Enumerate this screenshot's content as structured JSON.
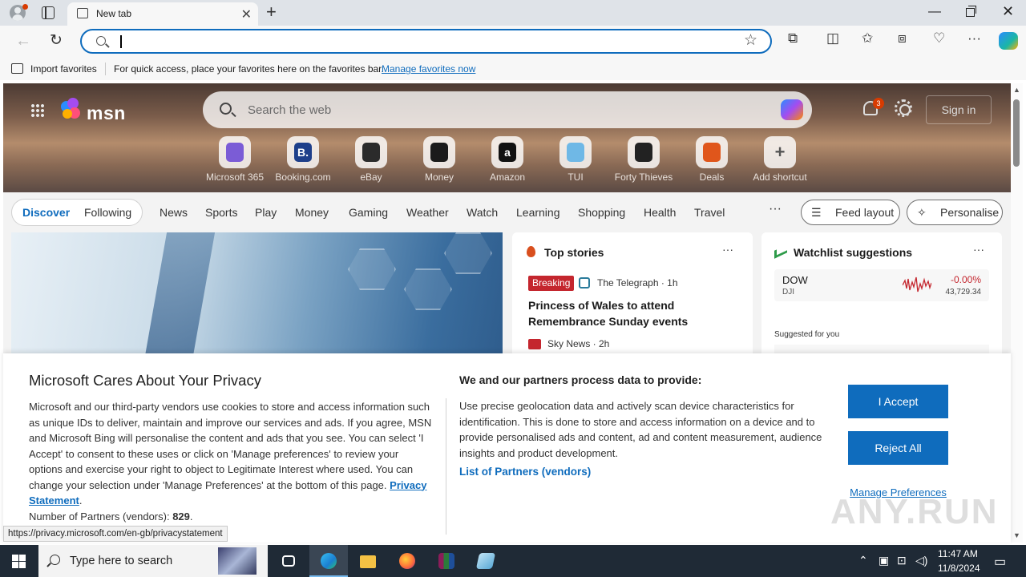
{
  "browser": {
    "tab_title": "New tab",
    "address_placeholder": "",
    "favorites_bar": {
      "import_label": "Import favorites",
      "hint": "For quick access, place your favorites here on the favorites bar.",
      "manage_link": "Manage favorites now"
    },
    "status_url": "https://privacy.microsoft.com/en-gb/privacystatement"
  },
  "msn": {
    "brand": "msn",
    "search_placeholder": "Search the web",
    "notification_count": "3",
    "signin_label": "Sign in",
    "shortcuts": [
      {
        "label": "Microsoft 365",
        "glyph": "",
        "color": "#7b5cd6"
      },
      {
        "label": "Booking.com",
        "glyph": "B.",
        "color": "#1e3f8a"
      },
      {
        "label": "eBay",
        "glyph": "",
        "color": "#2b2b2b"
      },
      {
        "label": "Money",
        "glyph": "",
        "color": "#1b1b1b"
      },
      {
        "label": "Amazon",
        "glyph": "a",
        "color": "#111111"
      },
      {
        "label": "TUI",
        "glyph": "",
        "color": "#6fb8e6"
      },
      {
        "label": "Forty Thieves",
        "glyph": "",
        "color": "#222222"
      },
      {
        "label": "Deals",
        "glyph": "",
        "color": "#e0561b"
      },
      {
        "label": "Add shortcut",
        "glyph": "+",
        "color": "transparent"
      }
    ],
    "feed_tabs": {
      "discover": "Discover",
      "following": "Following"
    },
    "nav_links": [
      "News",
      "Sports",
      "Play",
      "Money",
      "Gaming",
      "Weather",
      "Watch",
      "Learning",
      "Shopping",
      "Health",
      "Travel"
    ],
    "more_label": "···",
    "feed_layout_label": "Feed layout",
    "personalise_label": "Personalise",
    "top_stories": {
      "title": "Top stories",
      "badge": "Breaking",
      "source1": "The Telegraph · 1h",
      "headline": "Princess of Wales to attend Remembrance Sunday events",
      "source2": "Sky News · 2h"
    },
    "watchlist": {
      "title": "Watchlist suggestions",
      "stock_name": "DOW",
      "stock_symbol": "DJI",
      "stock_change": "-0.00%",
      "stock_value": "43,729.34",
      "suggested_label": "Suggested for you"
    }
  },
  "consent": {
    "title": "Microsoft Cares About Your Privacy",
    "body": "Microsoft and our third-party vendors use cookies to store and access information such as unique IDs to deliver, maintain and improve our services and ads. If you agree, MSN and Microsoft Bing will personalise the content and ads that you see. You can select 'I Accept' to consent to these uses or click on 'Manage preferences' to review your options and exercise your right to object to Legitimate Interest where used.  You can change your selection under 'Manage Preferences' at the bottom of this page.",
    "privacy_link": "Privacy Statement",
    "partners_count_label": "Number of Partners (vendors):",
    "partners_count": "829",
    "purposes_title": "We and our partners process data to provide:",
    "purposes_body": "Use precise geolocation data and actively scan device characteristics for identification. This is done to store and access information on a device and to provide personalised ads and content, ad and content measurement, audience insights and product development.",
    "partners_link": "List of Partners (vendors)",
    "accept_label": "I Accept",
    "reject_label": "Reject All",
    "manage_label": "Manage Preferences"
  },
  "taskbar": {
    "search_placeholder": "Type here to search",
    "time": "11:47 AM",
    "date": "11/8/2024"
  },
  "watermark": "ANY.RUN"
}
